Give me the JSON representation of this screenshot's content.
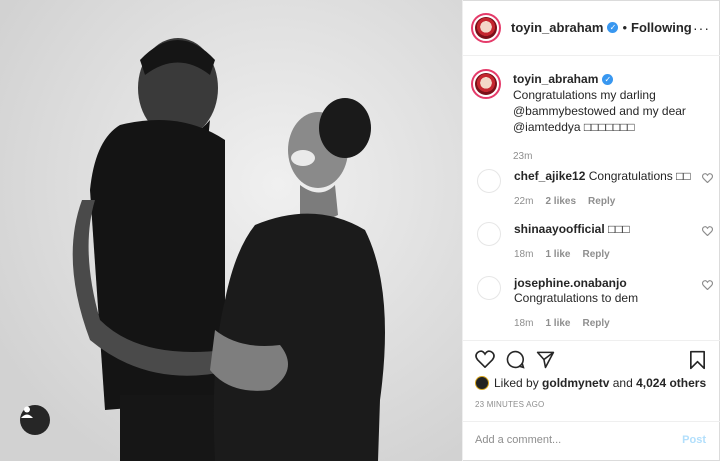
{
  "header": {
    "username": "toyin_abraham",
    "verified_mark": "✓",
    "separator": "•",
    "follow_status": "Following",
    "more_label": "···"
  },
  "caption": {
    "username": "toyin_abraham",
    "text": "Congratulations my darling @bammybestowed and my dear @iamteddya □□□□□□□",
    "time": "23m"
  },
  "comments": [
    {
      "username": "chef_ajike12",
      "text": "Congratulations □□",
      "time": "22m",
      "likes": "2 likes",
      "reply": "Reply"
    },
    {
      "username": "shinaayoofficial",
      "text": "□□□",
      "time": "18m",
      "likes": "1 like",
      "reply": "Reply"
    },
    {
      "username": "josephine.onabanjo",
      "text": "Congratulations to dem",
      "time": "18m",
      "likes": "1 like",
      "reply": "Reply"
    }
  ],
  "likes": {
    "prefix": "Liked by",
    "first_liker": "goldmynetv",
    "joiner": "and",
    "others": "4,024 others"
  },
  "posted_ago": "23 MINUTES AGO",
  "add_comment": {
    "placeholder": "Add a comment...",
    "post_label": "Post"
  },
  "colors": {
    "verified": "#3897f0",
    "story_ring": "#e53b6a",
    "post_button": "#b2dffc",
    "muted": "#8e8e8e"
  },
  "icons": [
    "heart-icon",
    "comment-icon",
    "share-icon",
    "bookmark-icon",
    "user-tag-icon",
    "more-icon"
  ]
}
